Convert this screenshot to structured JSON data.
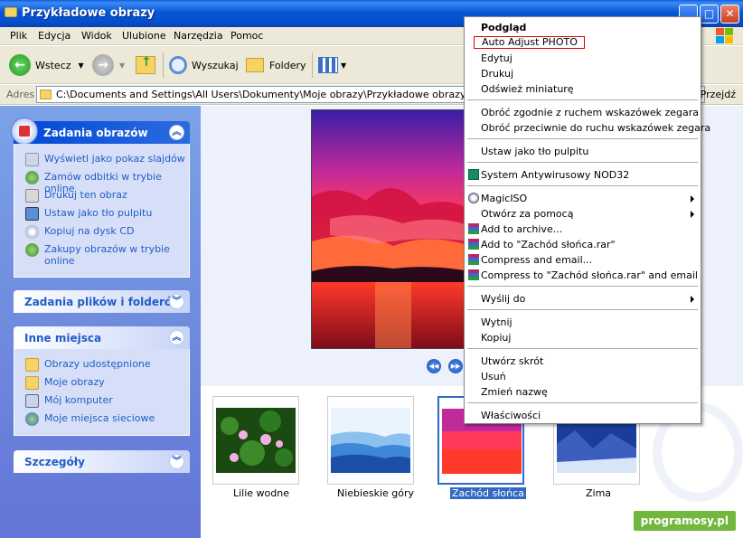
{
  "window": {
    "title": "Przykładowe obrazy"
  },
  "menubar": [
    "Plik",
    "Edycja",
    "Widok",
    "Ulubione",
    "Narzędzia",
    "Pomoc"
  ],
  "toolbar": {
    "back_label": "Wstecz",
    "search_label": "Wyszukaj",
    "folders_label": "Foldery"
  },
  "addressbar": {
    "label": "Adres",
    "path": "C:\\Documents and Settings\\All Users\\Dokumenty\\Moje obrazy\\Przykładowe obrazy",
    "go_label": "Przejdź"
  },
  "left_panel": {
    "image_tasks": {
      "title": "Zadania obrazów",
      "items": [
        "Wyświetl jako pokaz slajdów",
        "Zamów odbitki w trybie online",
        "Drukuj ten obraz",
        "Ustaw jako tło pulpitu",
        "Kopiuj na dysk CD",
        "Zakupy obrazów w trybie online"
      ]
    },
    "file_tasks": {
      "title": "Zadania plików i folderów"
    },
    "other_places": {
      "title": "Inne miejsca",
      "items": [
        "Obrazy udostępnione",
        "Moje obrazy",
        "Mój komputer",
        "Moje miejsca sieciowe"
      ]
    },
    "details": {
      "title": "Szczegóły"
    }
  },
  "thumbnails": [
    {
      "label": "Lilie wodne",
      "selected": false
    },
    {
      "label": "Niebieskie góry",
      "selected": false
    },
    {
      "label": "Zachód słońca",
      "selected": true
    },
    {
      "label": "Zima",
      "selected": false
    }
  ],
  "watermark": "programosy.pl",
  "context_menu": {
    "items": [
      {
        "label": "Podgląd",
        "bold": true
      },
      {
        "label": "Auto Adjust PHOTO",
        "highlighted": true
      },
      {
        "label": "Edytuj"
      },
      {
        "label": "Drukuj"
      },
      {
        "label": "Odśwież miniaturę"
      },
      {
        "label": "Obróć zgodnie z ruchem wskazówek zegara"
      },
      {
        "label": "Obróć przeciwnie do ruchu wskazówek zegara"
      },
      {
        "label": "Ustaw jako tło pulpitu"
      },
      {
        "label": "System Antywirusowy NOD32",
        "icon": "nod32-icon"
      },
      {
        "label": "MagicISO",
        "icon": "magiciso-icon",
        "submenu": true
      },
      {
        "label": "Otwórz za pomocą",
        "submenu": true
      },
      {
        "label": "Add to archive...",
        "icon": "winrar-icon"
      },
      {
        "label": "Add to \"Zachód słońca.rar\"",
        "icon": "winrar-icon"
      },
      {
        "label": "Compress and email...",
        "icon": "winrar-icon"
      },
      {
        "label": "Compress to \"Zachód słońca.rar\" and email",
        "icon": "winrar-icon"
      },
      {
        "label": "Wyślij do",
        "submenu": true
      },
      {
        "label": "Wytnij"
      },
      {
        "label": "Kopiuj"
      },
      {
        "label": "Utwórz skrót"
      },
      {
        "label": "Usuń"
      },
      {
        "label": "Zmień nazwę"
      },
      {
        "label": "Właściwości"
      }
    ]
  }
}
